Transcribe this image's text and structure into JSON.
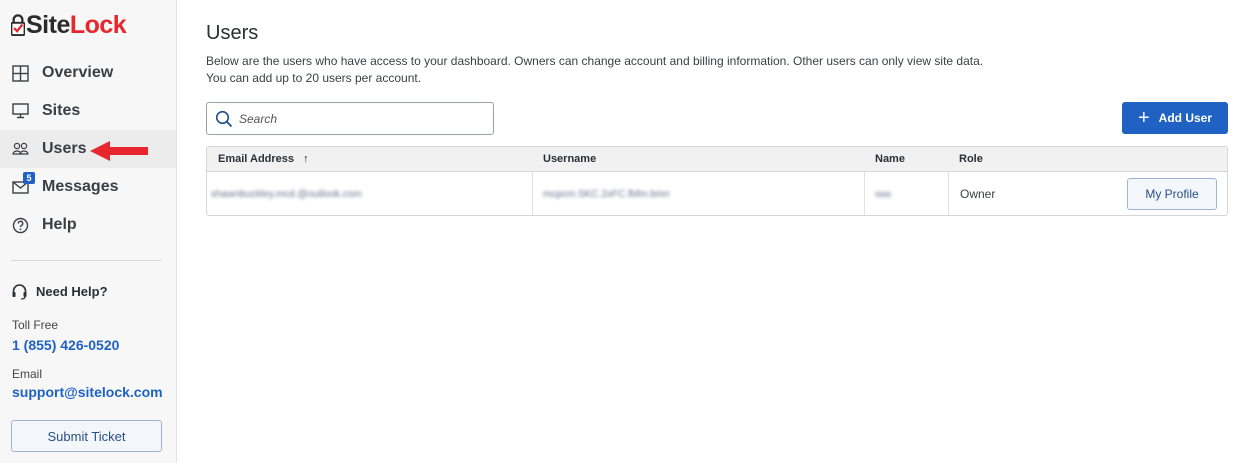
{
  "brand": {
    "name_part1": "Site",
    "name_part2": "Lock",
    "accent": "#e8262d",
    "primary": "#1f62c4"
  },
  "sidebar": {
    "items": [
      {
        "label": "Overview",
        "icon": "grid-icon"
      },
      {
        "label": "Sites",
        "icon": "monitor-icon"
      },
      {
        "label": "Users",
        "icon": "users-icon",
        "active": true
      },
      {
        "label": "Messages",
        "icon": "mail-icon",
        "badge": "5"
      },
      {
        "label": "Help",
        "icon": "question-icon"
      }
    ],
    "help": {
      "title": "Need Help?",
      "toll_free_label": "Toll Free",
      "phone": "1 (855) 426-0520",
      "email_label": "Email",
      "email": "support@sitelock.com",
      "submit_label": "Submit Ticket"
    }
  },
  "main": {
    "title": "Users",
    "description": "Below are the users who have access to your dashboard. Owners can change account and billing information. Other users can only view site data. You can add up to 20 users per account.",
    "search_placeholder": "Search",
    "add_user_label": "Add User",
    "table": {
      "columns": [
        "Email Address",
        "Username",
        "Name",
        "Role"
      ],
      "rows": [
        {
          "email": "shawnbuckley.mcd.@outlook.com",
          "username": "mcpcm.SKC.2xFC.fbfm.bmn",
          "name": "rbbb",
          "role": "Owner",
          "action": "My Profile"
        }
      ]
    }
  }
}
